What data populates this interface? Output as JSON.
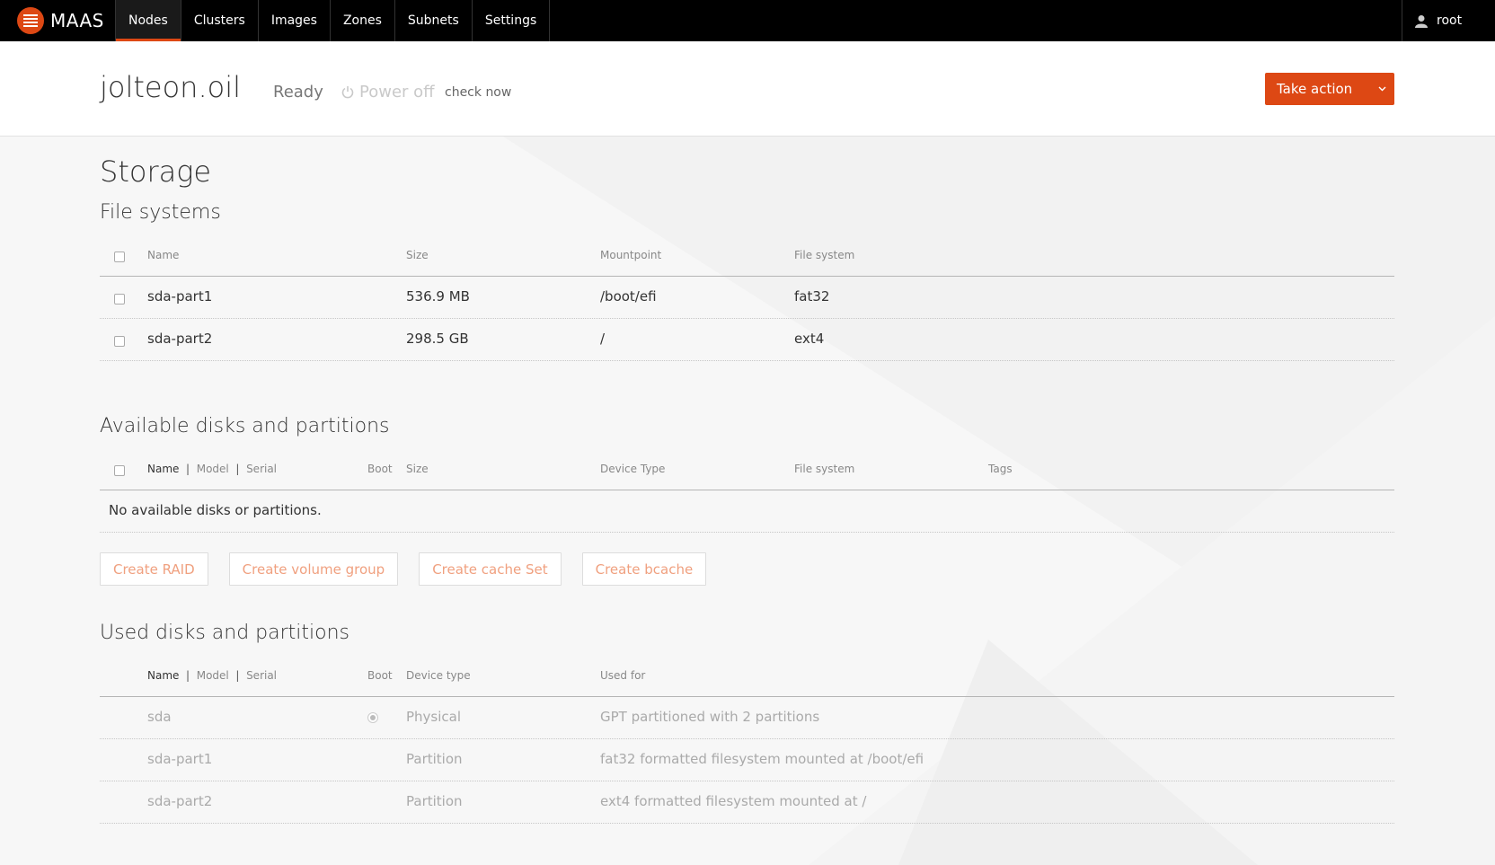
{
  "nav": {
    "brand": "MAAS",
    "items": [
      "Nodes",
      "Clusters",
      "Images",
      "Zones",
      "Subnets",
      "Settings"
    ],
    "active": "Nodes",
    "user": "root"
  },
  "header": {
    "node_name": "jolteon.oil",
    "status": "Ready",
    "power": "Power off",
    "check_now": "check now",
    "take_action": "Take action"
  },
  "page_title": "Storage",
  "file_systems": {
    "title": "File systems",
    "columns": [
      "Name",
      "Size",
      "Mountpoint",
      "File system"
    ],
    "rows": [
      {
        "name": "sda-part1",
        "size": "536.9 MB",
        "mountpoint": "/boot/efi",
        "fs": "fat32"
      },
      {
        "name": "sda-part2",
        "size": "298.5 GB",
        "mountpoint": "/",
        "fs": "ext4"
      }
    ]
  },
  "available": {
    "title": "Available disks and partitions",
    "columns": {
      "name": "Name",
      "model": "Model",
      "serial": "Serial",
      "boot": "Boot",
      "size": "Size",
      "device_type": "Device Type",
      "fs": "File system",
      "tags": "Tags"
    },
    "empty": "No available disks or partitions."
  },
  "buttons": [
    "Create RAID",
    "Create volume group",
    "Create cache Set",
    "Create bcache"
  ],
  "used": {
    "title": "Used disks and partitions",
    "columns": {
      "name": "Name",
      "model": "Model",
      "serial": "Serial",
      "boot": "Boot",
      "device_type": "Device type",
      "used_for": "Used for"
    },
    "rows": [
      {
        "name": "sda",
        "boot": true,
        "device_type": "Physical",
        "used_for": "GPT partitioned with 2 partitions"
      },
      {
        "name": "sda-part1",
        "boot": false,
        "device_type": "Partition",
        "used_for": "fat32 formatted filesystem mounted at /boot/efi"
      },
      {
        "name": "sda-part2",
        "boot": false,
        "device_type": "Partition",
        "used_for": "ext4 formatted filesystem mounted at /"
      }
    ]
  },
  "colors": {
    "accent": "#dd4814",
    "topbar": "#000000",
    "button_text": "#f0a07f"
  }
}
